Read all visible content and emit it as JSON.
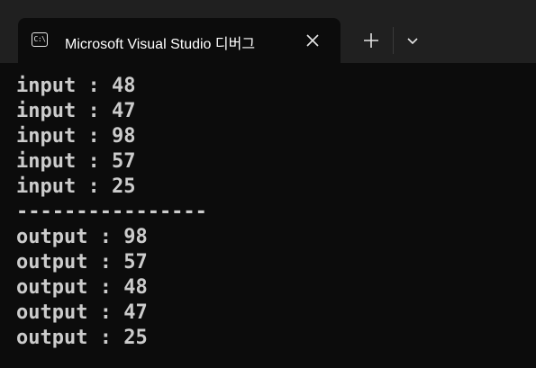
{
  "tab": {
    "icon": "console-icon",
    "icon_text": "C:\\",
    "title": "Microsoft Visual Studio 디버그",
    "close_icon": "close-icon"
  },
  "titlebar": {
    "new_tab_icon": "plus-icon",
    "dropdown_icon": "chevron-down-icon"
  },
  "console": {
    "lines": [
      "input : 48",
      "input : 47",
      "input : 98",
      "input : 57",
      "input : 25",
      "----------------",
      "output : 98",
      "output : 57",
      "output : 48",
      "output : 47",
      "output : 25"
    ]
  },
  "colors": {
    "terminal_bg": "#0c0c0c",
    "titlebar_bg": "#202020",
    "text": "#cccccc"
  }
}
